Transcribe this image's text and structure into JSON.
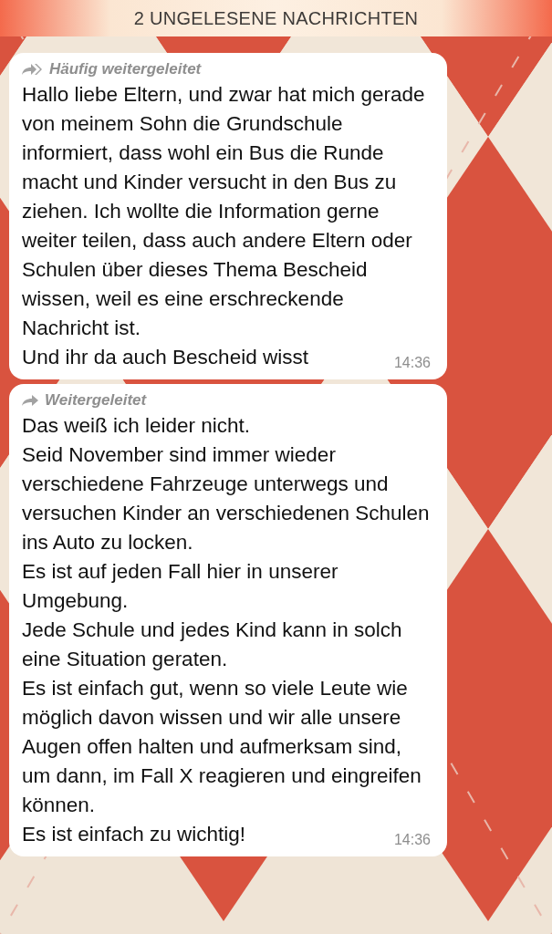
{
  "unread_banner": "2 UNGELESENE NACHRICHTEN",
  "messages": [
    {
      "forwarded": {
        "kind": "frequent",
        "label": "Häufig weitergeleitet"
      },
      "paragraphs": [
        "Hallo liebe Eltern, und zwar hat mich gerade von meinem Sohn die Grundschule informiert, dass wohl ein Bus die Runde macht und Kinder versucht in den Bus zu ziehen. Ich wollte die Information gerne weiter teilen, dass auch andere Eltern oder Schulen über dieses Thema Bescheid wissen, weil es eine erschreckende Nachricht ist.",
        "Und ihr da auch Bescheid wisst"
      ],
      "time": "14:36"
    },
    {
      "forwarded": {
        "kind": "single",
        "label": "Weitergeleitet"
      },
      "paragraphs": [
        "Das weiß ich leider nicht.",
        "Seid November sind immer wieder verschiedene Fahrzeuge unterwegs und versuchen Kinder an verschiedenen Schulen ins Auto zu locken.",
        "Es ist auf jeden Fall hier in unserer Umgebung.",
        "Jede Schule und jedes Kind kann in solch eine Situation geraten.",
        "Es ist einfach gut, wenn so viele Leute wie möglich davon wissen und wir alle unsere Augen offen halten und aufmerksam sind, um dann, im Fall X reagieren und eingreifen können.",
        "Es ist einfach zu wichtig!"
      ],
      "time": "14:36"
    }
  ]
}
